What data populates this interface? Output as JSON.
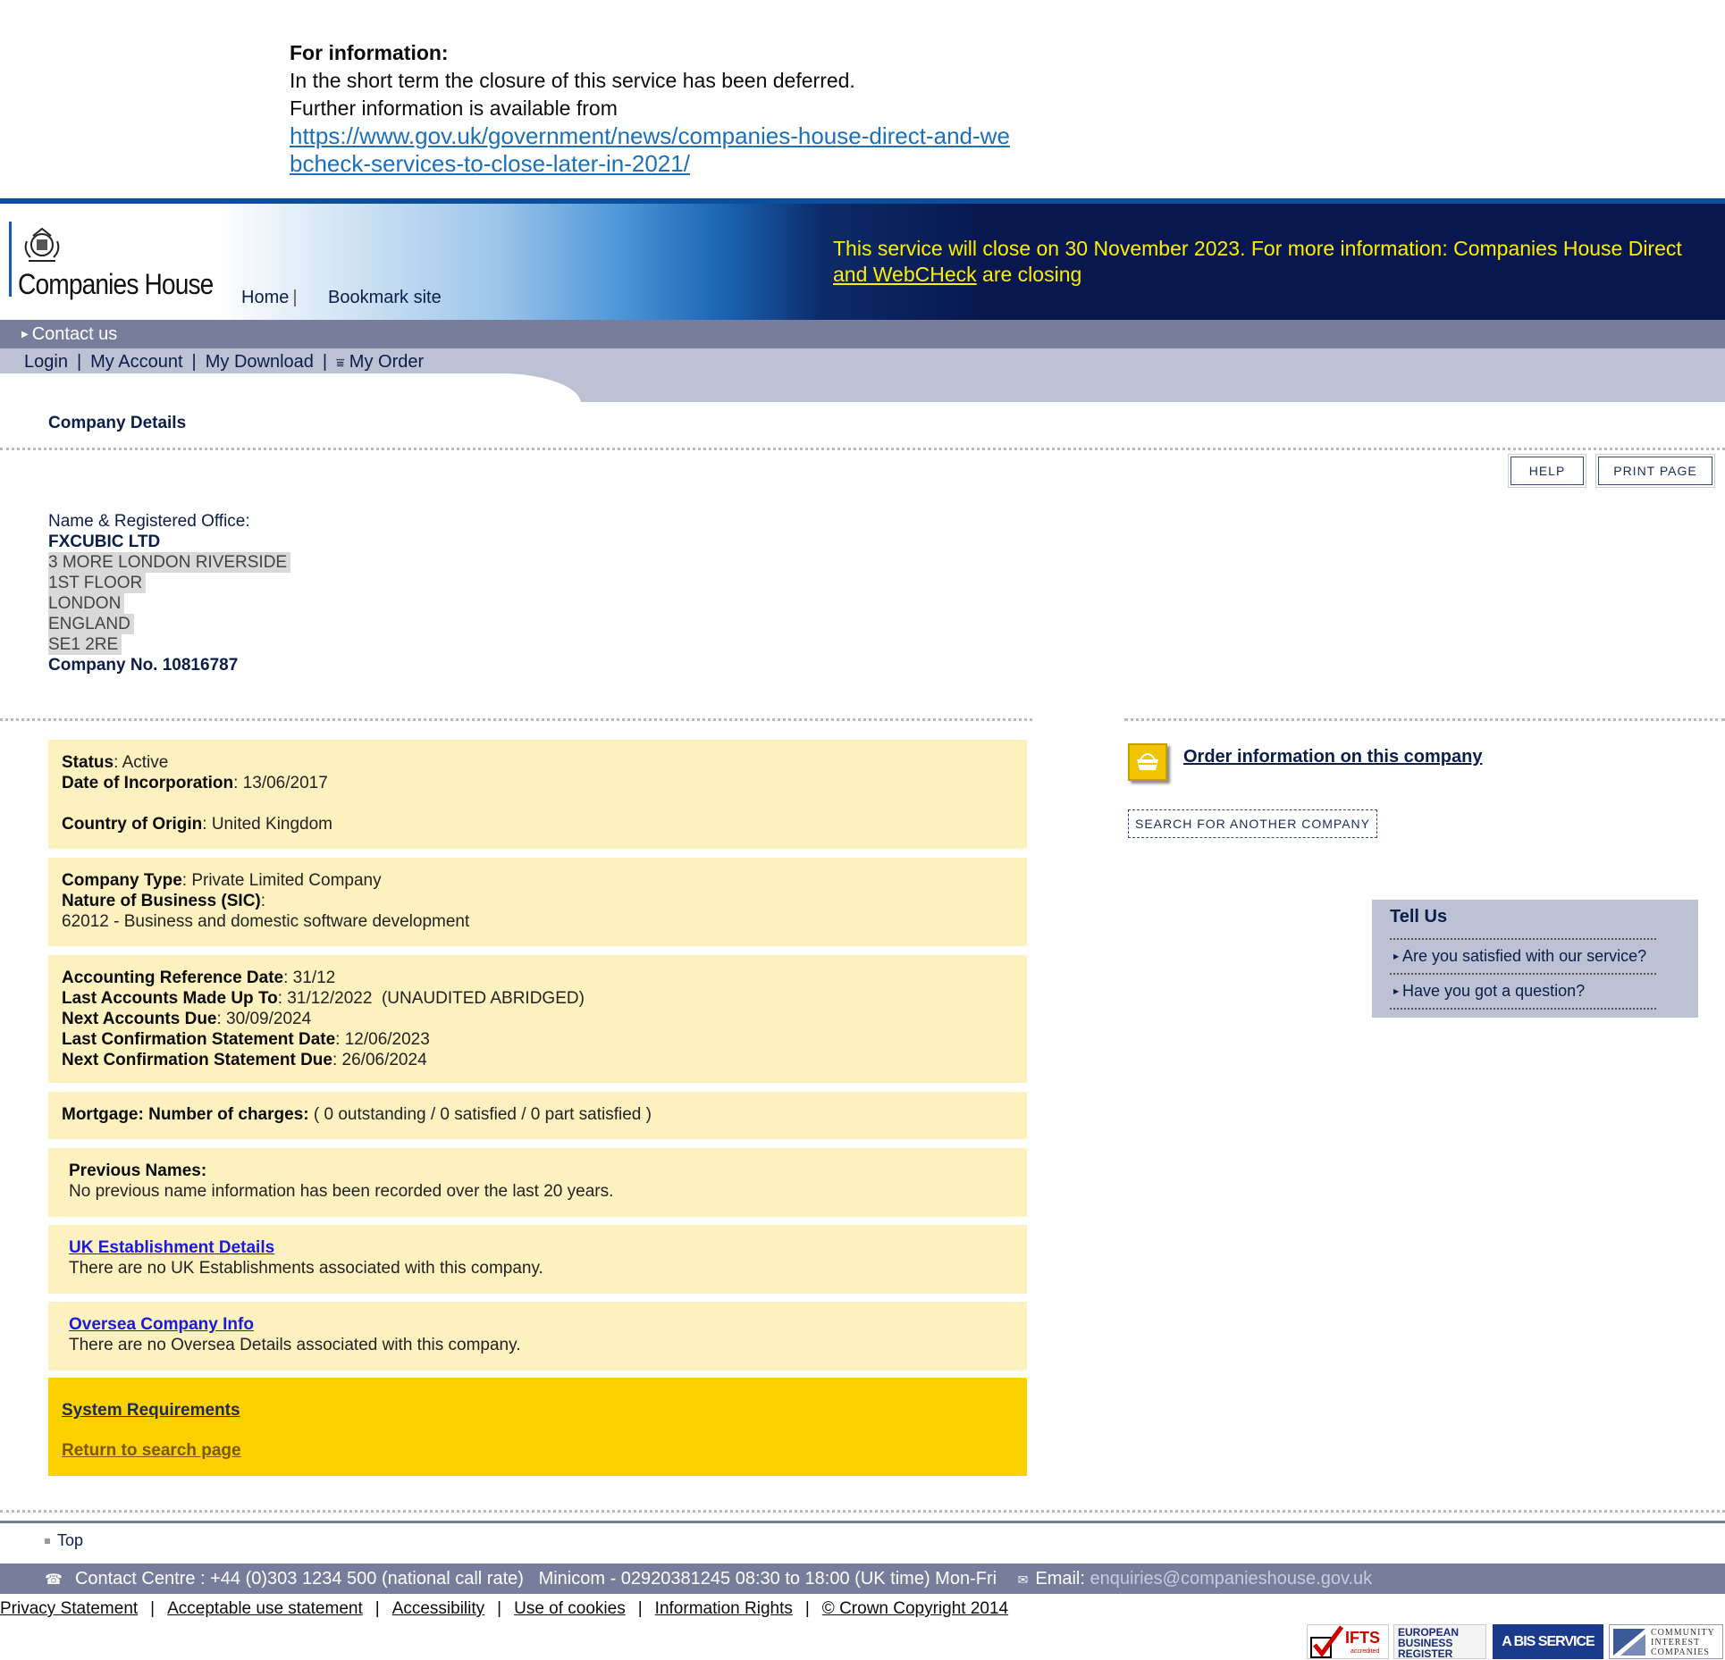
{
  "info": {
    "title": "For information:",
    "line1": "In the short term the closure of this service has been deferred.",
    "line2": "Further information is available from",
    "link": "https://www.gov.uk/government/news/companies-house-direct-and-webcheck-services-to-close-later-in-2021/"
  },
  "header": {
    "logo_text": "Companies House",
    "nav_home": "Home",
    "nav_sep": "|",
    "nav_bookmark": "Bookmark site",
    "closing_text": "This service will close on 30 November 2023. For more information: Companies House Direct",
    "closing_link": "and WebCHeck",
    "closing_tail": " are closing"
  },
  "menu": {
    "contact": "Contact us",
    "login": "Login",
    "account": "My Account",
    "download": "My Download",
    "order": "My Order",
    "sep": "|"
  },
  "page": {
    "section_title": "Company Details",
    "help": "HELP",
    "print": "PRINT PAGE"
  },
  "company": {
    "office_label": "Name & Registered Office:",
    "name": "FXCUBIC LTD",
    "address": [
      "3 MORE LONDON RIVERSIDE",
      "1ST FLOOR",
      "LONDON",
      "ENGLAND",
      "SE1 2RE"
    ],
    "number_label": "Company No. 10816787"
  },
  "details": {
    "status_label": "Status",
    "status": ": Active",
    "inc_label": "Date of Incorporation",
    "inc": ": 13/06/2017",
    "country_label": "Country of Origin",
    "country": ": United Kingdom",
    "type_label": "Company Type",
    "type": ": Private Limited Company",
    "sic_label": "Nature of Business (SIC)",
    "sic_colon": ":",
    "sic": "62012 - Business and domestic software development",
    "ard_label": "Accounting Reference Date",
    "ard": ": 31/12",
    "lamu_label": "Last Accounts Made Up To",
    "lamu": ": 31/12/2022  (UNAUDITED ABRIDGED)",
    "nad_label": "Next Accounts Due",
    "nad": ": 30/09/2024",
    "lcs_label": "Last Confirmation Statement Date",
    "lcs": ": 12/06/2023",
    "ncs_label": "Next Confirmation Statement Due",
    "ncs": ": 26/06/2024",
    "mortgage_label": "Mortgage: Number of charges:",
    "mortgage": " ( 0 outstanding / 0 satisfied / 0 part satisfied )",
    "prev_label": "Previous Names:",
    "prev": "No previous name information has been recorded over the last 20 years.",
    "uk_link": "UK Establishment Details",
    "uk": "There are no UK Establishments associated with this company.",
    "oversea_link": "Oversea Company Info",
    "oversea": "There are no Oversea Details associated with this company.",
    "sysreq": "System Requirements",
    "return": "Return to search page"
  },
  "side": {
    "order_link": "Order information on this company",
    "search_btn": "SEARCH FOR ANOTHER COMPANY",
    "tell_title": "Tell Us",
    "tell_items": [
      "Are you satisfied with our service?",
      "Have you got a question?"
    ]
  },
  "footer": {
    "top": "Top",
    "contact": "Contact Centre : +44 (0)303 1234 500 (national call rate)   Minicom - 02920381245 08:30 to 18:00 (UK time) Mon-Fri",
    "email_label": "Email:",
    "email": "enquiries@companieshouse.gov.uk",
    "links": [
      "Privacy Statement",
      "Acceptable use statement",
      "Accessibility",
      "Use of cookies",
      "Information Rights",
      "© Crown Copyright 2014"
    ],
    "sep": "|",
    "badge_ifts": "IFTS",
    "badge_ifts_sub": "accredited",
    "badge_ebr": [
      "EUROPEAN",
      "BUSINESS",
      "REGISTER"
    ],
    "badge_bis": "A BIS SERVICE",
    "badge_cic": [
      "COMMUNITY",
      "INTEREST",
      "COMPANIES"
    ]
  },
  "colors": {
    "banner_dark": "#08184e",
    "closing_yellow": "#ffee00",
    "bar_grey": "#777e9c",
    "panel_yellow": "#fdf1c0",
    "gold": "#fdd000"
  }
}
